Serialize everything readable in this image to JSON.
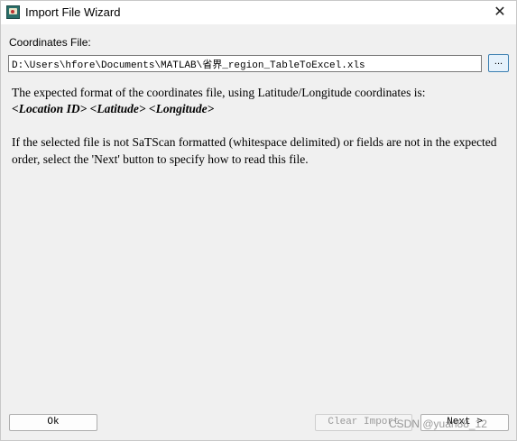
{
  "window": {
    "title": "Import File Wizard",
    "close_glyph": "✕",
    "icon": "satscan-app-icon"
  },
  "coordinates": {
    "label": "Coordinates File:",
    "path_value": "D:\\Users\\hfore\\Documents\\MATLAB\\省界_region_TableToExcel.xls",
    "browse_label": "..."
  },
  "description": {
    "line1": "The expected format of the coordinates file, using Latitude/Longitude coordinates is:",
    "format": "<Location ID> <Latitude> <Longitude>",
    "line2": "If the selected file is not SaTScan formatted (whitespace delimited) or fields are not in the expected order, select the 'Next' button to specify how to read this file."
  },
  "buttons": {
    "ok": "Ok",
    "clear_import": "Clear Import",
    "next": "Next >"
  },
  "watermark": "CSDN @yuan88_12"
}
